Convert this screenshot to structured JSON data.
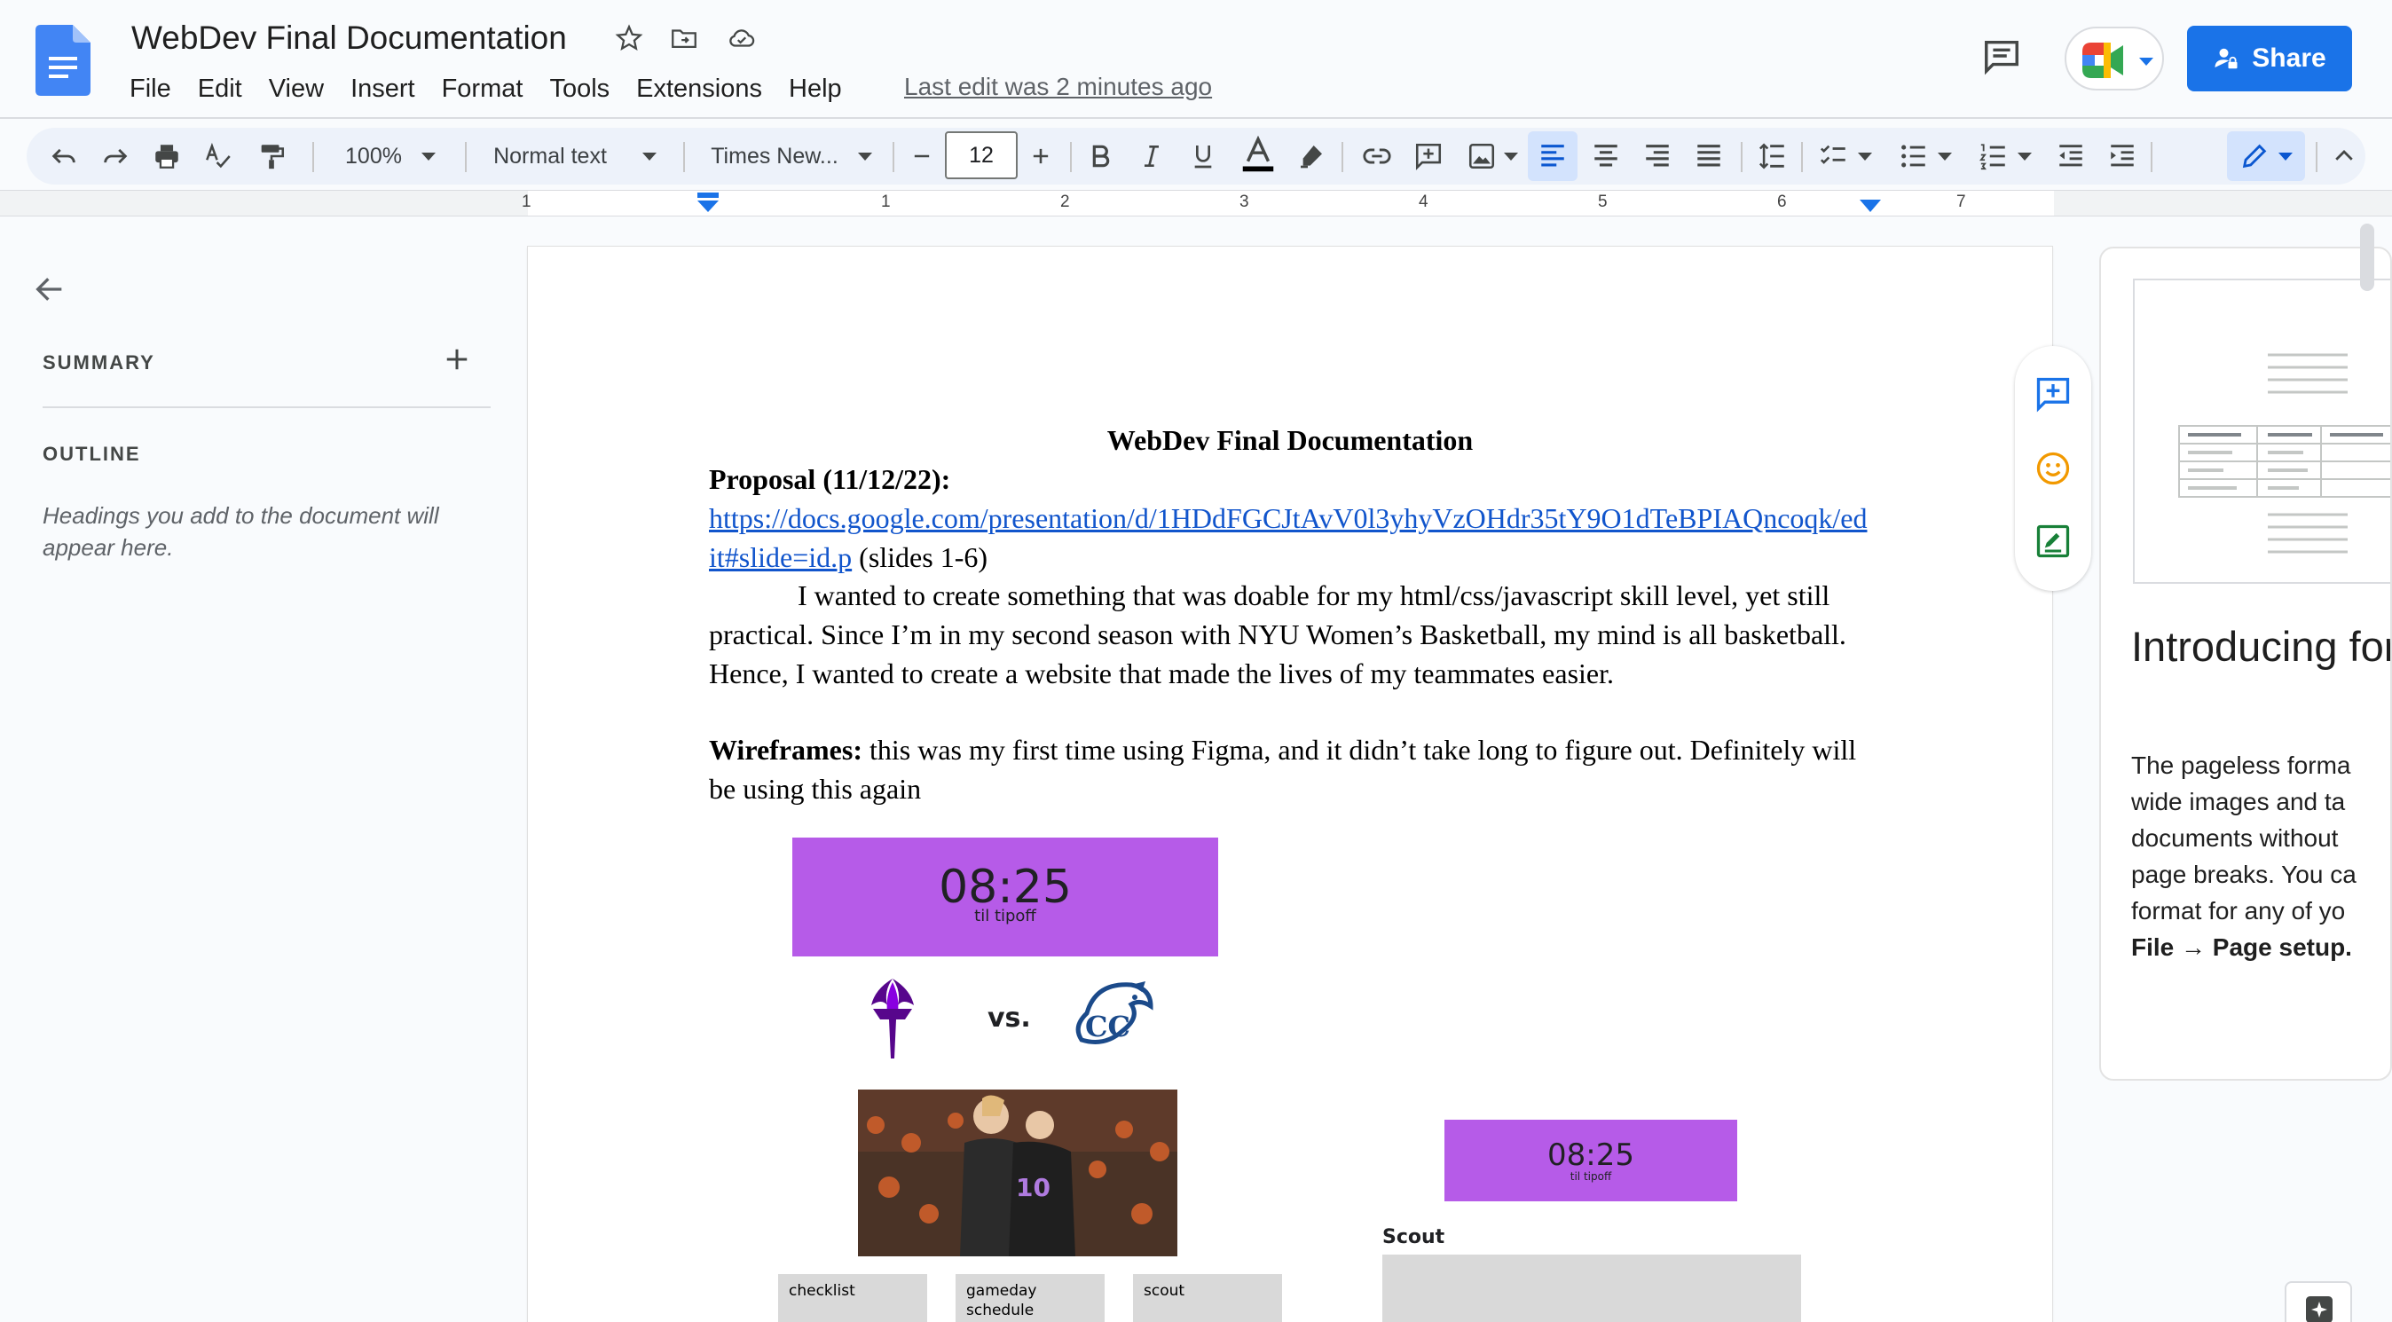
{
  "app": {
    "title": "WebDev Final Documentation",
    "last_edit": "Last edit was 2 minutes ago",
    "menu": [
      "File",
      "Edit",
      "View",
      "Insert",
      "Format",
      "Tools",
      "Extensions",
      "Help"
    ],
    "share_label": "Share",
    "accent_color": "#1a73e8"
  },
  "toolbar": {
    "zoom": "100%",
    "style": "Normal text",
    "font": "Times New...",
    "font_size": "12",
    "icons": [
      "undo-icon",
      "redo-icon",
      "print-icon",
      "spellcheck-icon",
      "paint-format-icon",
      "bold-icon",
      "italic-icon",
      "underline-icon",
      "text-color-icon",
      "highlight-icon",
      "link-icon",
      "add-comment-icon",
      "image-icon",
      "align-left-icon",
      "align-center-icon",
      "align-right-icon",
      "justify-icon",
      "line-spacing-icon",
      "checklist-icon",
      "bulleted-list-icon",
      "numbered-list-icon",
      "decrease-indent-icon",
      "increase-indent-icon",
      "editing-mode-icon",
      "collapse-icon"
    ]
  },
  "ruler": {
    "labels": [
      "1",
      "1",
      "2",
      "3",
      "4",
      "5",
      "6",
      "7"
    ]
  },
  "sidebar": {
    "summary_label": "SUMMARY",
    "outline_label": "OUTLINE",
    "outline_hint": "Headings you add to the document will appear here."
  },
  "document": {
    "heading": "WebDev Final Documentation",
    "proposal_label": "Proposal (11/12/22):",
    "link_text": "https://docs.google.com/presentation/d/1HDdFGCJtAvV0l3yhyVzOHdr35tY9O1dTeBPIAQncoqk/edit#slide=id.p",
    "link_suffix": " (slides 1-6)",
    "para1": "I wanted to create something that was doable for my html/css/javascript skill level, yet still practical. Since I’m in my second season with NYU Women’s Basketball, my mind is all basketball. Hence, I wanted to create a website that made the lives of my teammates easier.",
    "wireframes_label": "Wireframes:",
    "wireframes_text": " this was my first time using Figma, and it didn’t take long to figure out. Definitely will be using this again"
  },
  "mockup": {
    "timer": "08:25",
    "timer_caption": "til tipoff",
    "vs": "vs.",
    "player_number": "10",
    "buttons": [
      "checklist",
      "gameday schedule",
      "scout"
    ],
    "scout_label": "Scout",
    "timer_color": "#b65be8"
  },
  "promo": {
    "title": "Introducing format",
    "body_lines": [
      "The pageless forma",
      "wide images and ta",
      "documents without",
      "page breaks. You ca",
      "format for any of yo"
    ],
    "body_bold": "File → Page setup."
  }
}
